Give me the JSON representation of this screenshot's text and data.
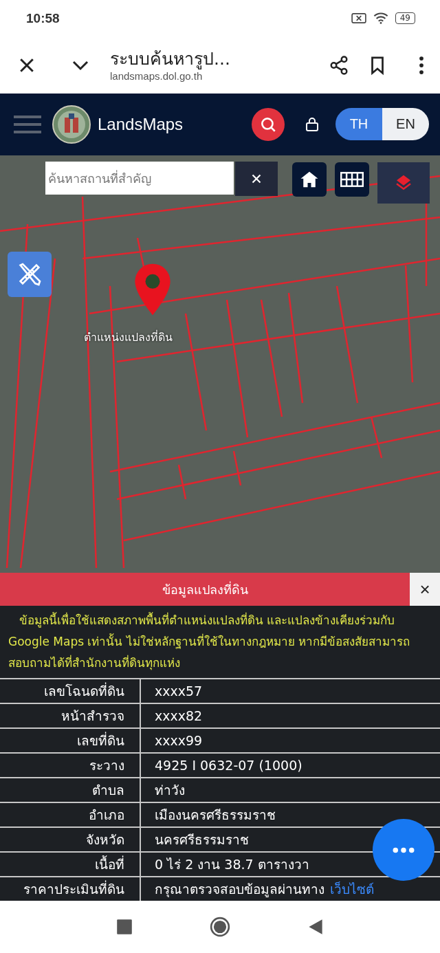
{
  "status_bar": {
    "time": "10:58",
    "battery": "49"
  },
  "browser": {
    "title": "ระบบค้นหารูป...",
    "url": "landsmaps.dol.go.th"
  },
  "app_header": {
    "brand": "LandsMaps",
    "languages": [
      {
        "label": "TH",
        "selected": true
      },
      {
        "label": "EN",
        "selected": false
      }
    ]
  },
  "map": {
    "search": {
      "placeholder": "ค้นหาสถานที่สำคัญ"
    },
    "marker_label": "ตำแหน่งแปลงที่ดิน"
  },
  "parcel_panel": {
    "title": "ข้อมูลแปลงที่ดิน",
    "close": "×",
    "disclaimer": "ข้อมูลนี้เพื่อใช้แสดงสภาพพื้นที่ตำแหน่งแปลงที่ดิน และแปลงข้างเคียงร่วมกับ Google Maps เท่านั้น ไม่ใช่หลักฐานที่ใช้ในทางกฎหมาย หากมีข้อสงสัยสามารถสอบถามได้ที่สำนักงานที่ดินทุกแห่ง",
    "rows": [
      {
        "label": "เลขโฉนดที่ดิน",
        "value": "xxxx57"
      },
      {
        "label": "หน้าสำรวจ",
        "value": "xxxx82"
      },
      {
        "label": "เลขที่ดิน",
        "value": "xxxx99"
      },
      {
        "label": "ระวาง",
        "value": "4925 I 0632-07 (1000)"
      },
      {
        "label": "ตำบล",
        "value": "ท่าวัง"
      },
      {
        "label": "อำเภอ",
        "value": "เมืองนครศรีธรรมราช"
      },
      {
        "label": "จังหวัด",
        "value": "นครศรีธรรมราช"
      },
      {
        "label": "เนื้อที่",
        "value": "0 ไร่ 2 งาน 38.7 ตารางวา"
      },
      {
        "label": "ราคาประเมินที่ดิน",
        "value": "กรุณาตรวจสอบข้อมูลผ่านทาง",
        "link": "เว็บไซต์"
      }
    ]
  }
}
